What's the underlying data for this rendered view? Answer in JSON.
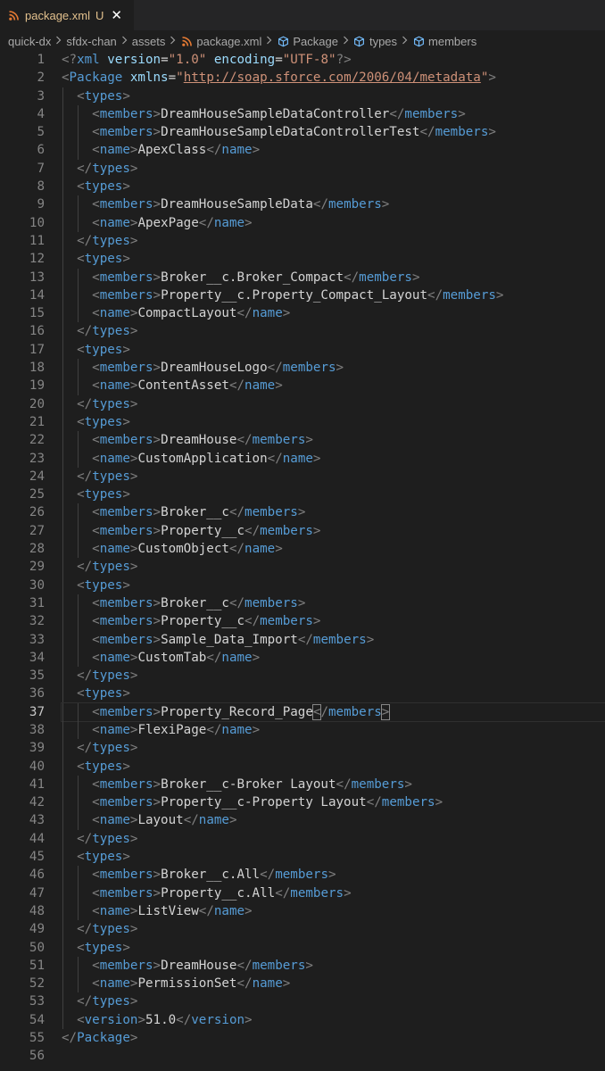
{
  "tab": {
    "icon": "rss-icon",
    "label": "package.xml",
    "status": "U",
    "close": "✕"
  },
  "breadcrumb": [
    {
      "label": "quick-dx",
      "icon": null
    },
    {
      "label": "sfdx-chan",
      "icon": null
    },
    {
      "label": "assets",
      "icon": null
    },
    {
      "label": "package.xml",
      "icon": "rss-icon"
    },
    {
      "label": "Package",
      "icon": "symbol-cube-icon"
    },
    {
      "label": "types",
      "icon": "symbol-cube-icon"
    },
    {
      "label": "members",
      "icon": "symbol-cube-icon"
    }
  ],
  "active_line": 37,
  "colors": {
    "background": "#1e1e1e",
    "tag": "#569cd6",
    "attribute": "#9cdcfe",
    "string": "#ce9178",
    "text": "#d4d4d4",
    "bracket": "#808080"
  },
  "lines": [
    [
      [
        "b",
        "<?"
      ],
      [
        "g",
        "xml"
      ],
      [
        "s",
        " "
      ],
      [
        "a",
        "version"
      ],
      [
        "e",
        "="
      ],
      [
        "r",
        "\"1.0\""
      ],
      [
        "s",
        " "
      ],
      [
        "a",
        "encoding"
      ],
      [
        "e",
        "="
      ],
      [
        "r",
        "\"UTF-8\""
      ],
      [
        "b",
        "?>"
      ]
    ],
    [
      [
        "b",
        "<"
      ],
      [
        "g",
        "Package"
      ],
      [
        "s",
        " "
      ],
      [
        "a",
        "xmlns"
      ],
      [
        "e",
        "="
      ],
      [
        "r",
        "\""
      ],
      [
        "u",
        "http://soap.sforce.com/2006/04/metadata"
      ],
      [
        "r",
        "\""
      ],
      [
        "b",
        ">"
      ]
    ],
    [
      [
        "s",
        "  "
      ],
      [
        "b",
        "<"
      ],
      [
        "g",
        "types"
      ],
      [
        "b",
        ">"
      ]
    ],
    [
      [
        "s",
        "    "
      ],
      [
        "b",
        "<"
      ],
      [
        "g",
        "members"
      ],
      [
        "b",
        ">"
      ],
      [
        "t",
        "DreamHouseSampleDataController"
      ],
      [
        "b",
        "</"
      ],
      [
        "g",
        "members"
      ],
      [
        "b",
        ">"
      ]
    ],
    [
      [
        "s",
        "    "
      ],
      [
        "b",
        "<"
      ],
      [
        "g",
        "members"
      ],
      [
        "b",
        ">"
      ],
      [
        "t",
        "DreamHouseSampleDataControllerTest"
      ],
      [
        "b",
        "</"
      ],
      [
        "g",
        "members"
      ],
      [
        "b",
        ">"
      ]
    ],
    [
      [
        "s",
        "    "
      ],
      [
        "b",
        "<"
      ],
      [
        "g",
        "name"
      ],
      [
        "b",
        ">"
      ],
      [
        "t",
        "ApexClass"
      ],
      [
        "b",
        "</"
      ],
      [
        "g",
        "name"
      ],
      [
        "b",
        ">"
      ]
    ],
    [
      [
        "s",
        "  "
      ],
      [
        "b",
        "</"
      ],
      [
        "g",
        "types"
      ],
      [
        "b",
        ">"
      ]
    ],
    [
      [
        "s",
        "  "
      ],
      [
        "b",
        "<"
      ],
      [
        "g",
        "types"
      ],
      [
        "b",
        ">"
      ]
    ],
    [
      [
        "s",
        "    "
      ],
      [
        "b",
        "<"
      ],
      [
        "g",
        "members"
      ],
      [
        "b",
        ">"
      ],
      [
        "t",
        "DreamHouseSampleData"
      ],
      [
        "b",
        "</"
      ],
      [
        "g",
        "members"
      ],
      [
        "b",
        ">"
      ]
    ],
    [
      [
        "s",
        "    "
      ],
      [
        "b",
        "<"
      ],
      [
        "g",
        "name"
      ],
      [
        "b",
        ">"
      ],
      [
        "t",
        "ApexPage"
      ],
      [
        "b",
        "</"
      ],
      [
        "g",
        "name"
      ],
      [
        "b",
        ">"
      ]
    ],
    [
      [
        "s",
        "  "
      ],
      [
        "b",
        "</"
      ],
      [
        "g",
        "types"
      ],
      [
        "b",
        ">"
      ]
    ],
    [
      [
        "s",
        "  "
      ],
      [
        "b",
        "<"
      ],
      [
        "g",
        "types"
      ],
      [
        "b",
        ">"
      ]
    ],
    [
      [
        "s",
        "    "
      ],
      [
        "b",
        "<"
      ],
      [
        "g",
        "members"
      ],
      [
        "b",
        ">"
      ],
      [
        "t",
        "Broker__c.Broker_Compact"
      ],
      [
        "b",
        "</"
      ],
      [
        "g",
        "members"
      ],
      [
        "b",
        ">"
      ]
    ],
    [
      [
        "s",
        "    "
      ],
      [
        "b",
        "<"
      ],
      [
        "g",
        "members"
      ],
      [
        "b",
        ">"
      ],
      [
        "t",
        "Property__c.Property_Compact_Layout"
      ],
      [
        "b",
        "</"
      ],
      [
        "g",
        "members"
      ],
      [
        "b",
        ">"
      ]
    ],
    [
      [
        "s",
        "    "
      ],
      [
        "b",
        "<"
      ],
      [
        "g",
        "name"
      ],
      [
        "b",
        ">"
      ],
      [
        "t",
        "CompactLayout"
      ],
      [
        "b",
        "</"
      ],
      [
        "g",
        "name"
      ],
      [
        "b",
        ">"
      ]
    ],
    [
      [
        "s",
        "  "
      ],
      [
        "b",
        "</"
      ],
      [
        "g",
        "types"
      ],
      [
        "b",
        ">"
      ]
    ],
    [
      [
        "s",
        "  "
      ],
      [
        "b",
        "<"
      ],
      [
        "g",
        "types"
      ],
      [
        "b",
        ">"
      ]
    ],
    [
      [
        "s",
        "    "
      ],
      [
        "b",
        "<"
      ],
      [
        "g",
        "members"
      ],
      [
        "b",
        ">"
      ],
      [
        "t",
        "DreamHouseLogo"
      ],
      [
        "b",
        "</"
      ],
      [
        "g",
        "members"
      ],
      [
        "b",
        ">"
      ]
    ],
    [
      [
        "s",
        "    "
      ],
      [
        "b",
        "<"
      ],
      [
        "g",
        "name"
      ],
      [
        "b",
        ">"
      ],
      [
        "t",
        "ContentAsset"
      ],
      [
        "b",
        "</"
      ],
      [
        "g",
        "name"
      ],
      [
        "b",
        ">"
      ]
    ],
    [
      [
        "s",
        "  "
      ],
      [
        "b",
        "</"
      ],
      [
        "g",
        "types"
      ],
      [
        "b",
        ">"
      ]
    ],
    [
      [
        "s",
        "  "
      ],
      [
        "b",
        "<"
      ],
      [
        "g",
        "types"
      ],
      [
        "b",
        ">"
      ]
    ],
    [
      [
        "s",
        "    "
      ],
      [
        "b",
        "<"
      ],
      [
        "g",
        "members"
      ],
      [
        "b",
        ">"
      ],
      [
        "t",
        "DreamHouse"
      ],
      [
        "b",
        "</"
      ],
      [
        "g",
        "members"
      ],
      [
        "b",
        ">"
      ]
    ],
    [
      [
        "s",
        "    "
      ],
      [
        "b",
        "<"
      ],
      [
        "g",
        "name"
      ],
      [
        "b",
        ">"
      ],
      [
        "t",
        "CustomApplication"
      ],
      [
        "b",
        "</"
      ],
      [
        "g",
        "name"
      ],
      [
        "b",
        ">"
      ]
    ],
    [
      [
        "s",
        "  "
      ],
      [
        "b",
        "</"
      ],
      [
        "g",
        "types"
      ],
      [
        "b",
        ">"
      ]
    ],
    [
      [
        "s",
        "  "
      ],
      [
        "b",
        "<"
      ],
      [
        "g",
        "types"
      ],
      [
        "b",
        ">"
      ]
    ],
    [
      [
        "s",
        "    "
      ],
      [
        "b",
        "<"
      ],
      [
        "g",
        "members"
      ],
      [
        "b",
        ">"
      ],
      [
        "t",
        "Broker__c"
      ],
      [
        "b",
        "</"
      ],
      [
        "g",
        "members"
      ],
      [
        "b",
        ">"
      ]
    ],
    [
      [
        "s",
        "    "
      ],
      [
        "b",
        "<"
      ],
      [
        "g",
        "members"
      ],
      [
        "b",
        ">"
      ],
      [
        "t",
        "Property__c"
      ],
      [
        "b",
        "</"
      ],
      [
        "g",
        "members"
      ],
      [
        "b",
        ">"
      ]
    ],
    [
      [
        "s",
        "    "
      ],
      [
        "b",
        "<"
      ],
      [
        "g",
        "name"
      ],
      [
        "b",
        ">"
      ],
      [
        "t",
        "CustomObject"
      ],
      [
        "b",
        "</"
      ],
      [
        "g",
        "name"
      ],
      [
        "b",
        ">"
      ]
    ],
    [
      [
        "s",
        "  "
      ],
      [
        "b",
        "</"
      ],
      [
        "g",
        "types"
      ],
      [
        "b",
        ">"
      ]
    ],
    [
      [
        "s",
        "  "
      ],
      [
        "b",
        "<"
      ],
      [
        "g",
        "types"
      ],
      [
        "b",
        ">"
      ]
    ],
    [
      [
        "s",
        "    "
      ],
      [
        "b",
        "<"
      ],
      [
        "g",
        "members"
      ],
      [
        "b",
        ">"
      ],
      [
        "t",
        "Broker__c"
      ],
      [
        "b",
        "</"
      ],
      [
        "g",
        "members"
      ],
      [
        "b",
        ">"
      ]
    ],
    [
      [
        "s",
        "    "
      ],
      [
        "b",
        "<"
      ],
      [
        "g",
        "members"
      ],
      [
        "b",
        ">"
      ],
      [
        "t",
        "Property__c"
      ],
      [
        "b",
        "</"
      ],
      [
        "g",
        "members"
      ],
      [
        "b",
        ">"
      ]
    ],
    [
      [
        "s",
        "    "
      ],
      [
        "b",
        "<"
      ],
      [
        "g",
        "members"
      ],
      [
        "b",
        ">"
      ],
      [
        "t",
        "Sample_Data_Import"
      ],
      [
        "b",
        "</"
      ],
      [
        "g",
        "members"
      ],
      [
        "b",
        ">"
      ]
    ],
    [
      [
        "s",
        "    "
      ],
      [
        "b",
        "<"
      ],
      [
        "g",
        "name"
      ],
      [
        "b",
        ">"
      ],
      [
        "t",
        "CustomTab"
      ],
      [
        "b",
        "</"
      ],
      [
        "g",
        "name"
      ],
      [
        "b",
        ">"
      ]
    ],
    [
      [
        "s",
        "  "
      ],
      [
        "b",
        "</"
      ],
      [
        "g",
        "types"
      ],
      [
        "b",
        ">"
      ]
    ],
    [
      [
        "s",
        "  "
      ],
      [
        "b",
        "<"
      ],
      [
        "g",
        "types"
      ],
      [
        "b",
        ">"
      ]
    ],
    [
      [
        "s",
        "    "
      ],
      [
        "b",
        "<"
      ],
      [
        "g",
        "members"
      ],
      [
        "b",
        ">"
      ],
      [
        "t",
        "Property_Record_Page"
      ],
      [
        "B",
        "<"
      ],
      [
        "b",
        "/"
      ],
      [
        "g",
        "members"
      ],
      [
        "B",
        ">"
      ]
    ],
    [
      [
        "s",
        "    "
      ],
      [
        "b",
        "<"
      ],
      [
        "g",
        "name"
      ],
      [
        "b",
        ">"
      ],
      [
        "t",
        "FlexiPage"
      ],
      [
        "b",
        "</"
      ],
      [
        "g",
        "name"
      ],
      [
        "b",
        ">"
      ]
    ],
    [
      [
        "s",
        "  "
      ],
      [
        "b",
        "</"
      ],
      [
        "g",
        "types"
      ],
      [
        "b",
        ">"
      ]
    ],
    [
      [
        "s",
        "  "
      ],
      [
        "b",
        "<"
      ],
      [
        "g",
        "types"
      ],
      [
        "b",
        ">"
      ]
    ],
    [
      [
        "s",
        "    "
      ],
      [
        "b",
        "<"
      ],
      [
        "g",
        "members"
      ],
      [
        "b",
        ">"
      ],
      [
        "t",
        "Broker__c-Broker Layout"
      ],
      [
        "b",
        "</"
      ],
      [
        "g",
        "members"
      ],
      [
        "b",
        ">"
      ]
    ],
    [
      [
        "s",
        "    "
      ],
      [
        "b",
        "<"
      ],
      [
        "g",
        "members"
      ],
      [
        "b",
        ">"
      ],
      [
        "t",
        "Property__c-Property Layout"
      ],
      [
        "b",
        "</"
      ],
      [
        "g",
        "members"
      ],
      [
        "b",
        ">"
      ]
    ],
    [
      [
        "s",
        "    "
      ],
      [
        "b",
        "<"
      ],
      [
        "g",
        "name"
      ],
      [
        "b",
        ">"
      ],
      [
        "t",
        "Layout"
      ],
      [
        "b",
        "</"
      ],
      [
        "g",
        "name"
      ],
      [
        "b",
        ">"
      ]
    ],
    [
      [
        "s",
        "  "
      ],
      [
        "b",
        "</"
      ],
      [
        "g",
        "types"
      ],
      [
        "b",
        ">"
      ]
    ],
    [
      [
        "s",
        "  "
      ],
      [
        "b",
        "<"
      ],
      [
        "g",
        "types"
      ],
      [
        "b",
        ">"
      ]
    ],
    [
      [
        "s",
        "    "
      ],
      [
        "b",
        "<"
      ],
      [
        "g",
        "members"
      ],
      [
        "b",
        ">"
      ],
      [
        "t",
        "Broker__c.All"
      ],
      [
        "b",
        "</"
      ],
      [
        "g",
        "members"
      ],
      [
        "b",
        ">"
      ]
    ],
    [
      [
        "s",
        "    "
      ],
      [
        "b",
        "<"
      ],
      [
        "g",
        "members"
      ],
      [
        "b",
        ">"
      ],
      [
        "t",
        "Property__c.All"
      ],
      [
        "b",
        "</"
      ],
      [
        "g",
        "members"
      ],
      [
        "b",
        ">"
      ]
    ],
    [
      [
        "s",
        "    "
      ],
      [
        "b",
        "<"
      ],
      [
        "g",
        "name"
      ],
      [
        "b",
        ">"
      ],
      [
        "t",
        "ListView"
      ],
      [
        "b",
        "</"
      ],
      [
        "g",
        "name"
      ],
      [
        "b",
        ">"
      ]
    ],
    [
      [
        "s",
        "  "
      ],
      [
        "b",
        "</"
      ],
      [
        "g",
        "types"
      ],
      [
        "b",
        ">"
      ]
    ],
    [
      [
        "s",
        "  "
      ],
      [
        "b",
        "<"
      ],
      [
        "g",
        "types"
      ],
      [
        "b",
        ">"
      ]
    ],
    [
      [
        "s",
        "    "
      ],
      [
        "b",
        "<"
      ],
      [
        "g",
        "members"
      ],
      [
        "b",
        ">"
      ],
      [
        "t",
        "DreamHouse"
      ],
      [
        "b",
        "</"
      ],
      [
        "g",
        "members"
      ],
      [
        "b",
        ">"
      ]
    ],
    [
      [
        "s",
        "    "
      ],
      [
        "b",
        "<"
      ],
      [
        "g",
        "name"
      ],
      [
        "b",
        ">"
      ],
      [
        "t",
        "PermissionSet"
      ],
      [
        "b",
        "</"
      ],
      [
        "g",
        "name"
      ],
      [
        "b",
        ">"
      ]
    ],
    [
      [
        "s",
        "  "
      ],
      [
        "b",
        "</"
      ],
      [
        "g",
        "types"
      ],
      [
        "b",
        ">"
      ]
    ],
    [
      [
        "s",
        "  "
      ],
      [
        "b",
        "<"
      ],
      [
        "g",
        "version"
      ],
      [
        "b",
        ">"
      ],
      [
        "t",
        "51.0"
      ],
      [
        "b",
        "</"
      ],
      [
        "g",
        "version"
      ],
      [
        "b",
        ">"
      ]
    ],
    [
      [
        "b",
        "</"
      ],
      [
        "g",
        "Package"
      ],
      [
        "b",
        ">"
      ]
    ],
    []
  ]
}
